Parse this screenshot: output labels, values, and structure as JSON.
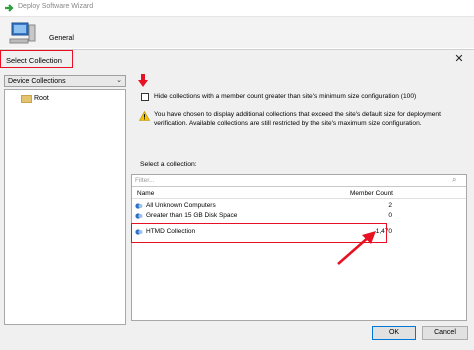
{
  "wizard": {
    "title": "Deploy Software Wizard",
    "page_label": "General"
  },
  "dialog": {
    "title": "Select Collection",
    "collection_type": "Device Collections",
    "tree": {
      "root": "Root"
    },
    "hide_option": "Hide collections with a member count greater than site's minimum size configuration (100)",
    "warning": "You have chosen to display additional collections that exceed the site's default size for deployment verification. Available collections are still restricted by the site's maximum size configuration.",
    "select_label": "Select a collection:",
    "filter_placeholder": "Filter...",
    "columns": {
      "name": "Name",
      "count": "Member Count"
    },
    "rows": [
      {
        "name": "All Unknown Computers",
        "count": "2"
      },
      {
        "name": "Greater than 15 GB Disk Space",
        "count": "0"
      },
      {
        "name": "HTMD Collection",
        "count": "1,470"
      }
    ],
    "ok_label": "OK",
    "cancel_label": "Cancel"
  },
  "colors": {
    "highlight": "#e81123",
    "accent": "#0078d7"
  }
}
